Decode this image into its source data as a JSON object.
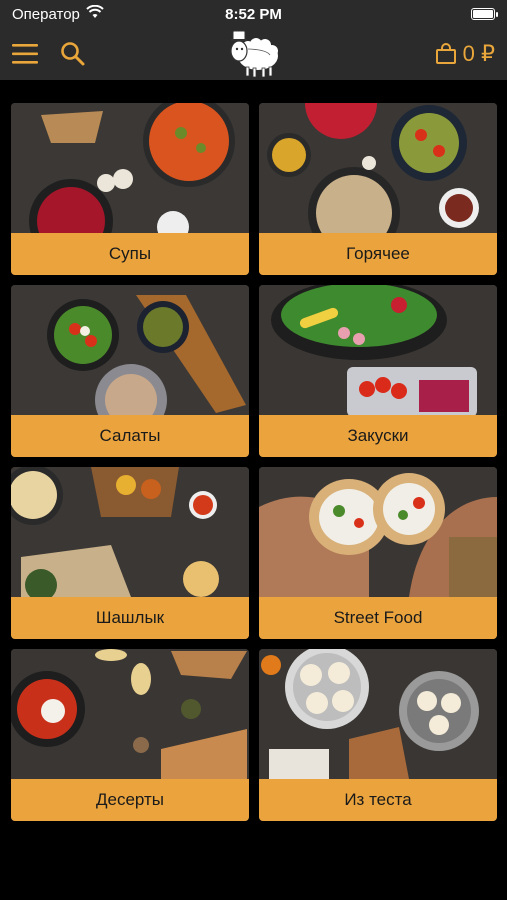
{
  "status_bar": {
    "carrier": "Оператор",
    "time": "8:52 PM"
  },
  "nav": {
    "cart_count": "0 ₽"
  },
  "categories": [
    {
      "label": "Супы",
      "photo_icon": "soup-bowls-photo"
    },
    {
      "label": "Горячее",
      "photo_icon": "hot-dishes-photo"
    },
    {
      "label": "Салаты",
      "photo_icon": "salads-photo"
    },
    {
      "label": "Закуски",
      "photo_icon": "appetizers-photo"
    },
    {
      "label": "Шашлык",
      "photo_icon": "shashlik-photo"
    },
    {
      "label": "Street Food",
      "photo_icon": "wrap-photo"
    },
    {
      "label": "Десерты",
      "photo_icon": "desserts-photo"
    },
    {
      "label": "Из теста",
      "photo_icon": "dumplings-photo"
    }
  ],
  "colors": {
    "accent": "#eba43d",
    "bar_bg": "#2b2b2b",
    "page_bg": "#000000"
  }
}
